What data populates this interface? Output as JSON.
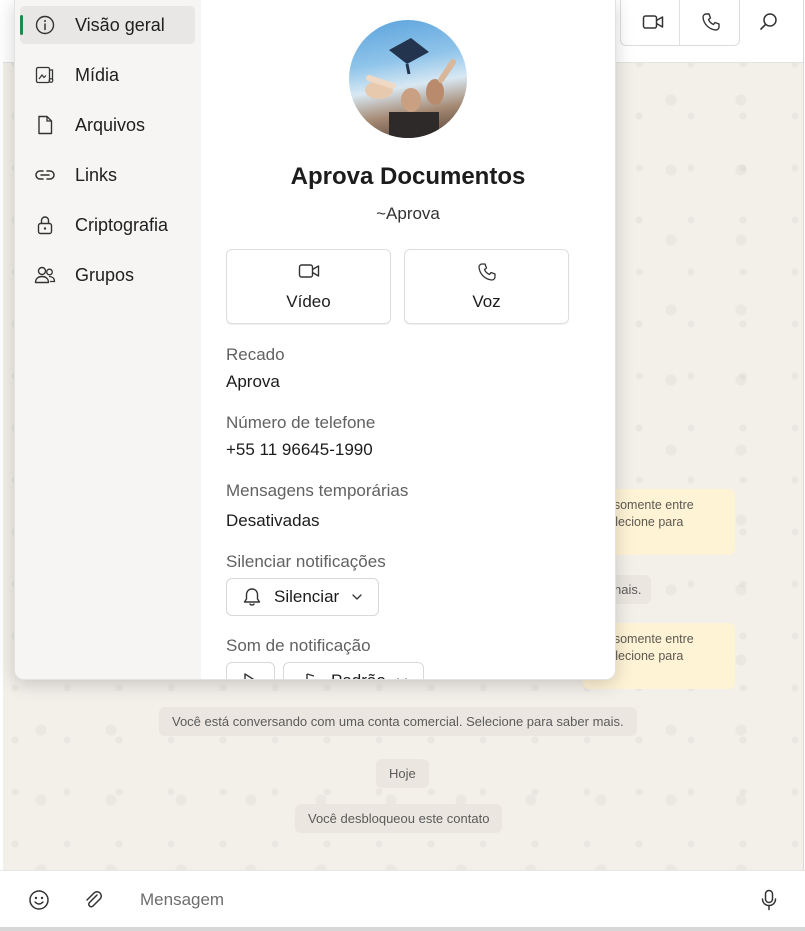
{
  "chat": {
    "notices": [
      {
        "line1": "am somente entre",
        "line2": ". Selecione para"
      },
      {
        "line1": "am somente entre",
        "line2": ". Selecione para"
      }
    ],
    "partial_system": "nais.",
    "business_notice": "Você está conversando com uma conta comercial. Selecione para saber mais.",
    "date_chip": "Hoje",
    "unblocked_notice": "Você desbloqueou este contato"
  },
  "composer": {
    "placeholder": "Mensagem"
  },
  "side_nav": {
    "items": [
      {
        "label": "Visão geral",
        "icon": "info-icon"
      },
      {
        "label": "Mídia",
        "icon": "media-icon"
      },
      {
        "label": "Arquivos",
        "icon": "file-icon"
      },
      {
        "label": "Links",
        "icon": "link-icon"
      },
      {
        "label": "Criptografia",
        "icon": "lock-icon"
      },
      {
        "label": "Grupos",
        "icon": "groups-icon"
      }
    ],
    "active_index": 0
  },
  "profile": {
    "name": "Aprova Documentos",
    "push_name": "~Aprova",
    "video_label": "Vídeo",
    "voice_label": "Voz",
    "about_label": "Recado",
    "about_value": "Aprova",
    "phone_label": "Número de telefone",
    "phone_value": "+55 11 96645-1990",
    "disappearing_label": "Mensagens temporárias",
    "disappearing_value": "Desativadas",
    "mute_label": "Silenciar notificações",
    "mute_value": "Silenciar",
    "sound_label": "Som de notificação",
    "sound_value": "Padrão"
  },
  "colors": {
    "accent": "#1d8b4e",
    "notice_bg": "#fff3d6",
    "chat_bg": "#f3efe9"
  }
}
